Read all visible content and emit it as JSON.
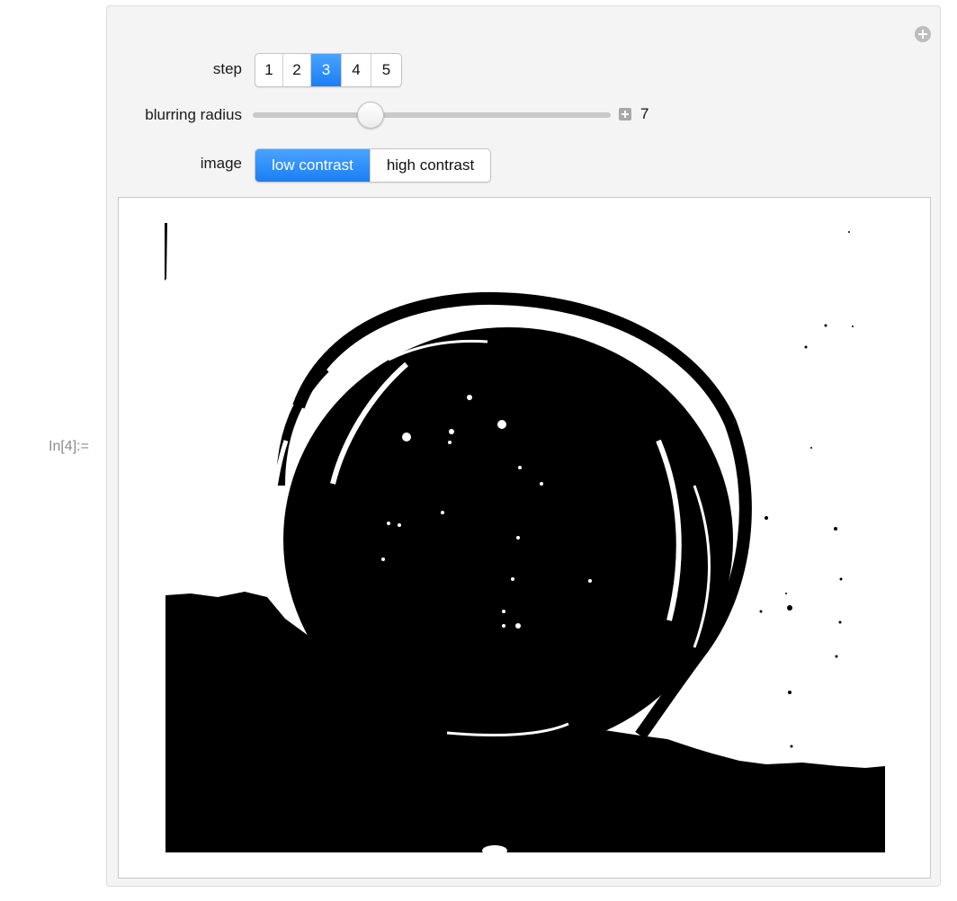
{
  "cell": {
    "input_label": "In[4]:="
  },
  "controls": {
    "step": {
      "label": "step",
      "options": [
        "1",
        "2",
        "3",
        "4",
        "5"
      ],
      "selected": "3"
    },
    "blurring_radius": {
      "label": "blurring radius",
      "value": "7",
      "min": 0,
      "max": 20,
      "level": 0.33
    },
    "image": {
      "label": "image",
      "options": [
        "low contrast",
        "high contrast"
      ],
      "selected": "low contrast"
    }
  },
  "icons": {
    "panel_options": "plus-circle-icon",
    "slider_expand": "plus-square-icon"
  },
  "colors": {
    "accent": "#1a7ef5",
    "panel_background": "#f4f4f4",
    "image_foreground": "#000000",
    "image_background": "#ffffff"
  }
}
